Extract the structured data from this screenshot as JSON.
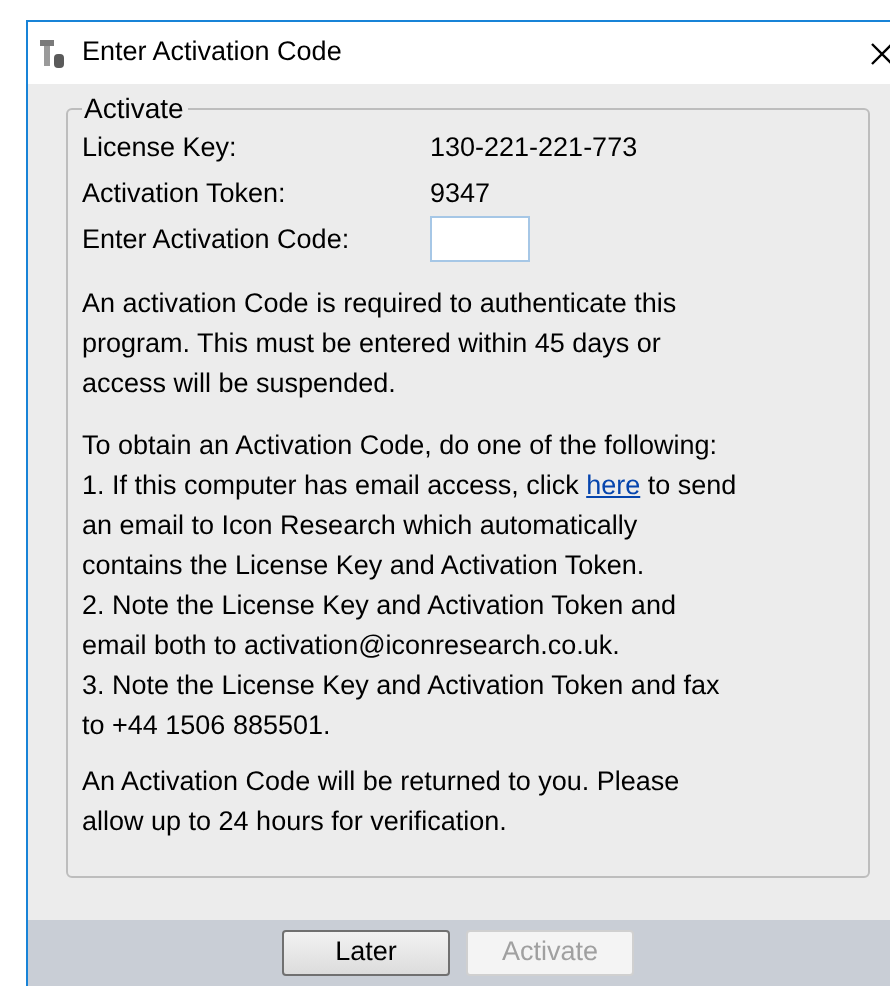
{
  "window": {
    "title": "Enter Activation Code"
  },
  "group": {
    "title": "Activate",
    "fields": [
      {
        "label": "License Key:",
        "value": "130-221-221-773"
      },
      {
        "label": "Activation Token:",
        "value": "9347"
      }
    ],
    "code_field": {
      "label": "Enter Activation Code:"
    },
    "notice": "An activation Code is required to authenticate this program. This must be entered within 45 days or access will be suspended.",
    "intro": "To obtain an Activation Code, do one of the following:",
    "steps": [
      {
        "text": "1. If this computer has email access, click ",
        "link": "here",
        "text_after": " to send an email to Icon Research which automatically contains the License Key and Activation Token."
      },
      {
        "text": "2. Note the License Key and Activation Token and email both to activation@iconresearch.co.uk."
      },
      {
        "text": "3. Note the License Key and Activation Token and fax to +44 1506 885501."
      }
    ],
    "footer": "An Activation Code will be returned to you. Please allow up to 24 hours for verification."
  },
  "buttons": [
    {
      "label": "Later",
      "disabled": false
    },
    {
      "label": "Activate",
      "disabled": true
    }
  ]
}
